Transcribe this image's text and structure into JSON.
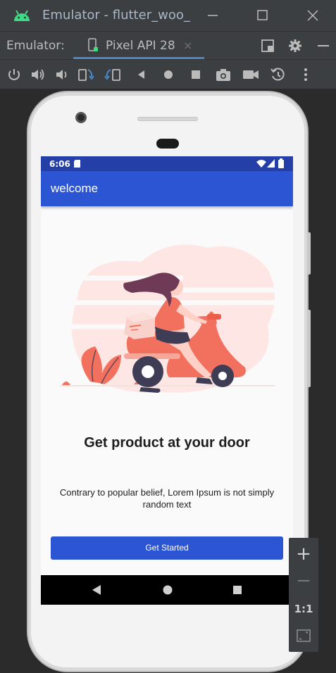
{
  "window": {
    "title": "Emulator - flutter_woo_"
  },
  "tabbar": {
    "label": "Emulator:",
    "tab_label": "Pixel API 28",
    "tab_close": "×"
  },
  "toolbar": {
    "icons": [
      "power-icon",
      "volume-up-icon",
      "volume-down-icon",
      "rotate-left-icon",
      "rotate-right-icon",
      "back-icon",
      "home-icon",
      "overview-icon",
      "screenshot-icon",
      "screenrecord-icon",
      "snapshot-icon",
      "more-icon"
    ]
  },
  "device": {
    "status_time": "6:06",
    "appbar_title": "welcome",
    "headline": "Get product at your door",
    "description": "Contrary to popular belief, Lorem Ipsum is not simply random text",
    "cta_label": "Get Started"
  },
  "zoom": {
    "plus": "+",
    "minus": "−",
    "fit": "1:1"
  },
  "colors": {
    "appbar": "#2b55d3",
    "statusbar": "#2440a8",
    "accent_tab": "#4a88c7",
    "ide_bg": "#3c3f41",
    "illustration_primary": "#f2705e"
  }
}
